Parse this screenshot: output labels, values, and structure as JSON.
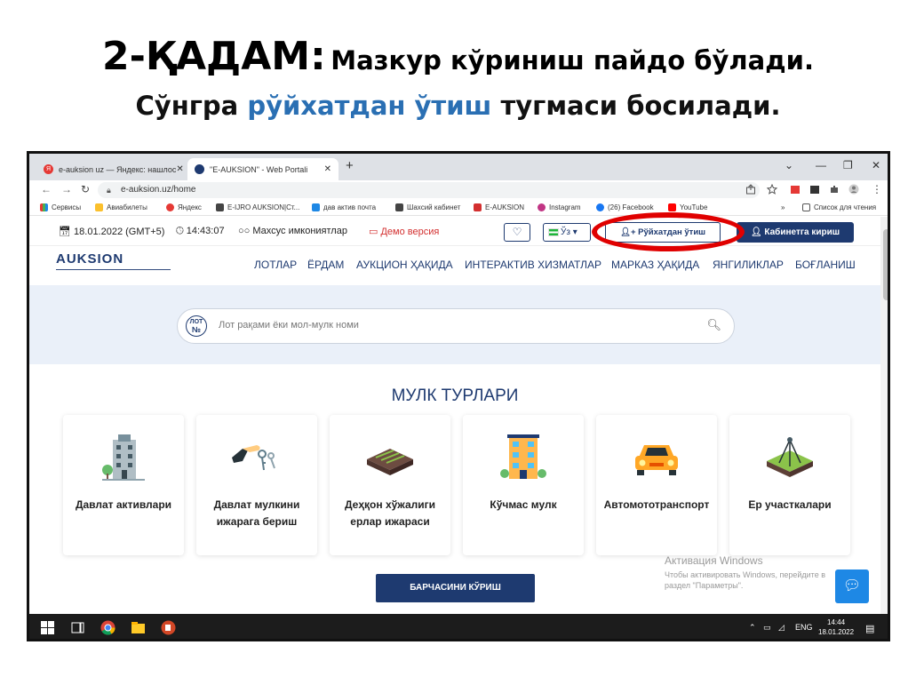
{
  "slide": {
    "title_big": "2-ҚАДАМ:",
    "title_rest": "Мазкур кўриниш пайдо бўлади.",
    "sub_pre": "Сўнгра",
    "sub_highlight": "рўйхатдан ўтиш",
    "sub_post": "тугмаси босилади."
  },
  "browser": {
    "tabs": [
      {
        "label": "e-auksion uz — Яндекс: нашлос",
        "close": "✕"
      },
      {
        "label": "\"E-AUKSION\" - Web Portali",
        "close": "✕"
      }
    ],
    "new_tab": "+",
    "url": "e-auksion.uz/home",
    "bookmarks": [
      "Сервисы",
      "Авиабилеты",
      "Яндекс",
      "E-IJRO AUKSION|Ст...",
      "дав актив почта",
      "Шахсий кабинет",
      "E-AUKSION",
      "Instagram",
      "(26) Facebook",
      "YouTube"
    ],
    "bookmarks_more": "»",
    "reading_list": "Список для чтения"
  },
  "site": {
    "date": "18.01.2022 (GMT+5)",
    "time": "14:43:07",
    "special": "Махсус имкониятлар",
    "demo": "Демо версия",
    "lang": "Ўз",
    "register": "Рўйхатдан ўтиш",
    "login": "Кабинетга кириш",
    "logo": "AUKSION",
    "nav": [
      "ЛОТЛАР",
      "ЁРДАМ",
      "АУКЦИОН ҲАҚИДА",
      "ИНТЕРАКТИВ ХИЗМАТЛАР",
      "МАРКАЗ ҲАҚИДА",
      "ЯНГИЛИКЛАР",
      "БОҒЛАНИШ"
    ],
    "search_badge_top": "ЛОТ",
    "search_badge_bottom": "№",
    "search_placeholder": "Лот рақами ёки мол-мулк номи",
    "section_title": "МУЛК ТУРЛАРИ",
    "cards": [
      {
        "line1": "Давлат активлари",
        "line2": "",
        "icon": "building-icon"
      },
      {
        "line1": "Давлат мулкини",
        "line2": "ижарага бериш",
        "icon": "hand-keys-icon"
      },
      {
        "line1": "Деҳқон хўжалиги",
        "line2": "ерлар ижараси",
        "icon": "farmland-icon"
      },
      {
        "line1": "Кўчмас мулк",
        "line2": "",
        "icon": "real-estate-icon"
      },
      {
        "line1": "Автомототранспорт",
        "line2": "",
        "icon": "car-icon"
      },
      {
        "line1": "Ер участкалари",
        "line2": "",
        "icon": "land-plot-icon"
      }
    ],
    "view_all": "БАРЧАСИНИ КЎРИШ"
  },
  "windows_activation": {
    "title": "Активация Windows",
    "line1": "Чтобы активировать Windows, перейдите в",
    "line2": "раздел \"Параметры\"."
  },
  "taskbar": {
    "lang": "ENG",
    "time": "14:44",
    "date": "18.01.2022"
  },
  "colors": {
    "brand_navy": "#1e3a70",
    "highlight_blue": "#2a6fb3",
    "annotation_red": "#e00000",
    "demo_red": "#d32f2f"
  }
}
